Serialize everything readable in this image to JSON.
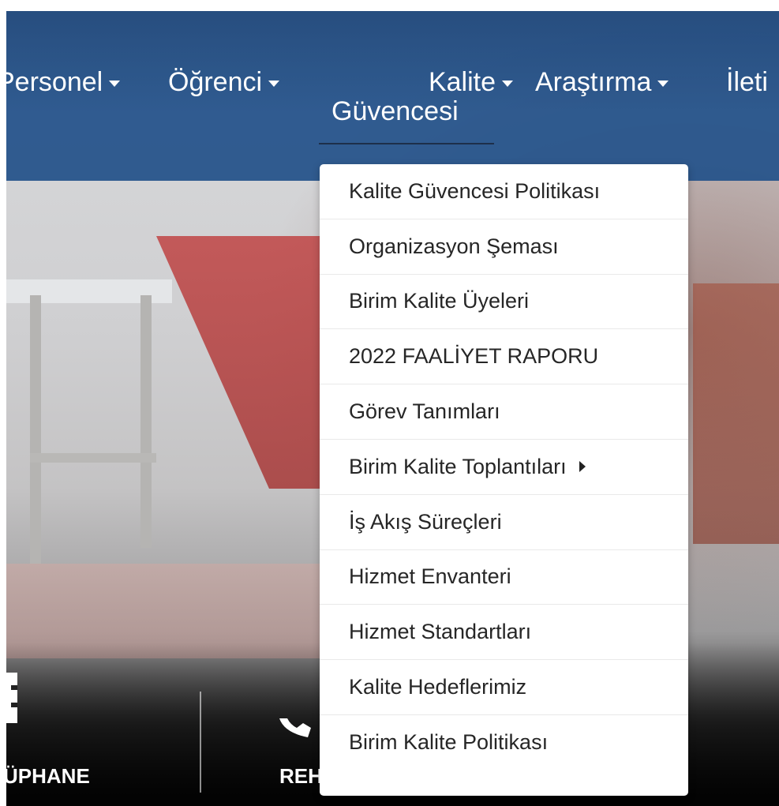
{
  "nav": {
    "items": [
      {
        "label": "Personel"
      },
      {
        "label": "Öğrenci"
      },
      {
        "label_line1": "Kalite",
        "label_line2": "Güvencesi"
      },
      {
        "label": "Araştırma"
      },
      {
        "label": "İleti"
      }
    ]
  },
  "dropdown": {
    "items": [
      {
        "label": "Kalite Güvencesi Politikası"
      },
      {
        "label": "Organizasyon Şeması"
      },
      {
        "label": "Birim Kalite Üyeleri"
      },
      {
        "label": "2022 FAALİYET RAPORU"
      },
      {
        "label": "Görev Tanımları"
      },
      {
        "label": "Birim Kalite Toplantıları",
        "has_submenu": true
      },
      {
        "label": "İş Akış Süreçleri"
      },
      {
        "label": "Hizmet Envanteri"
      },
      {
        "label": "Hizmet Standartları"
      },
      {
        "label": "Kalite Hedeflerimiz"
      },
      {
        "label": "Birim Kalite Politikası"
      }
    ]
  },
  "quick_links": {
    "left_label": "ÜPHANE",
    "right_label": "REH"
  },
  "colors": {
    "navbar": "#24528a",
    "menu_text": "#262626"
  }
}
